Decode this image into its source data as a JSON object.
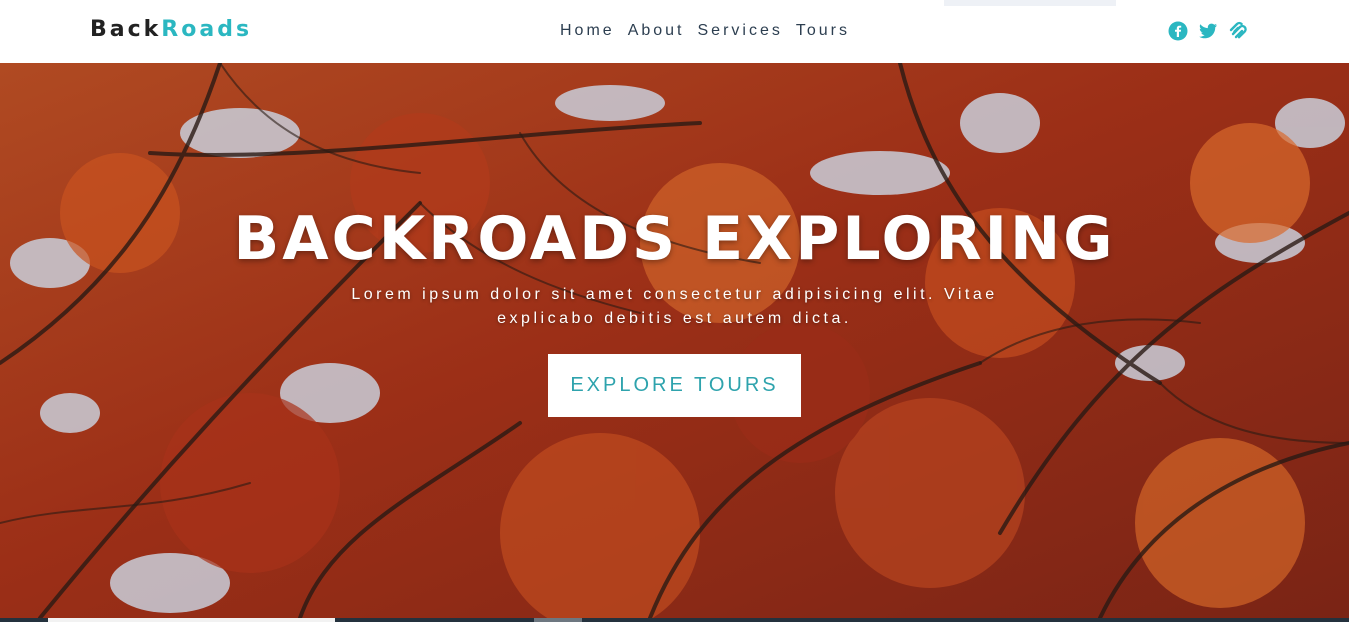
{
  "brand": {
    "part1": "Back",
    "part2": "Roads"
  },
  "nav": {
    "links": [
      {
        "label": "Home"
      },
      {
        "label": "About"
      },
      {
        "label": "Services"
      },
      {
        "label": "Tours"
      }
    ]
  },
  "socials": [
    {
      "icon": "facebook-icon"
    },
    {
      "icon": "twitter-icon"
    },
    {
      "icon": "squarespace-icon"
    }
  ],
  "hero": {
    "title": "BACKROADS EXPLORING",
    "text": "Lorem ipsum dolor sit amet consectetur adipisicing elit. Vitae explicabo debitis est autem dicta.",
    "button_label": "EXPLORE TOURS"
  },
  "colors": {
    "accent": "#2bb7c1",
    "button_text": "#2ea3ad",
    "nav_text": "#2c3e50"
  }
}
